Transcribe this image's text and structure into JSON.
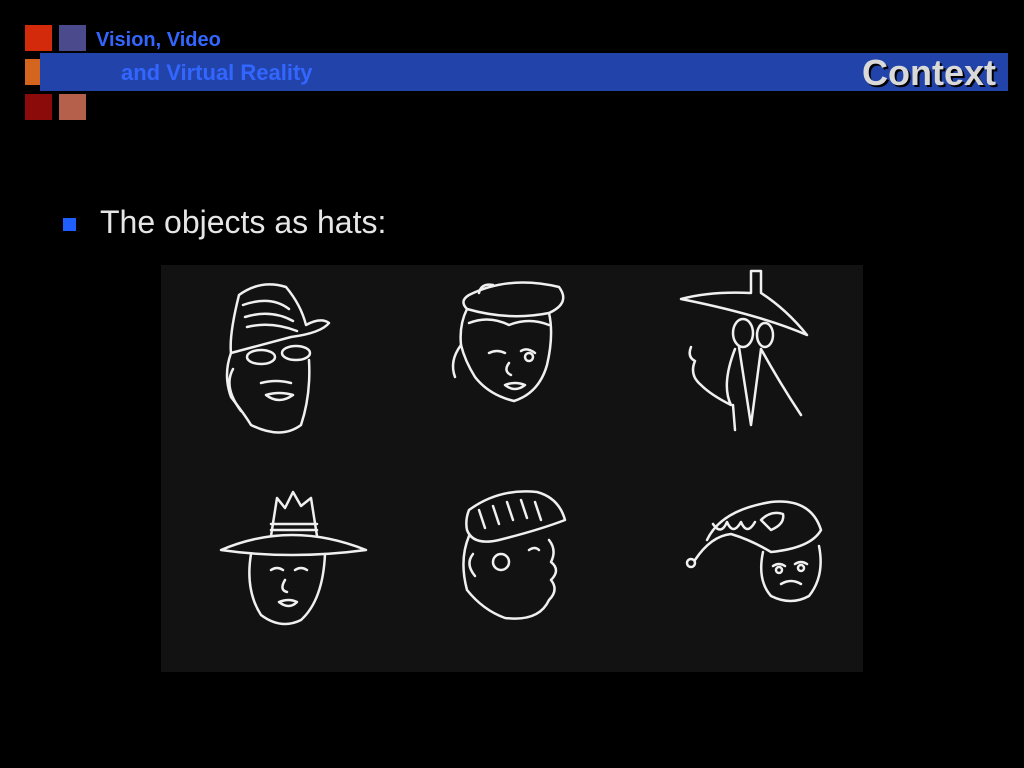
{
  "header": {
    "line1": "Vision, Video",
    "line2": "and Virtual Reality",
    "title": "Context"
  },
  "logo_colors": [
    "#d42a0c",
    "#4a4a8c",
    "#d4651e",
    "#b8283c",
    "#8b0a0a",
    "#b5604a"
  ],
  "accent_bar_color": "#2244aa",
  "bullet": {
    "text": "The objects as hats:",
    "color": "#1f5fff"
  },
  "figure": {
    "drawings": [
      "fedora-with-sunglasses-icon",
      "beret-icon",
      "witch-hat-figure-icon",
      "wide-brim-hat-icon",
      "knit-cap-profile-icon",
      "nightcap-icon"
    ]
  }
}
